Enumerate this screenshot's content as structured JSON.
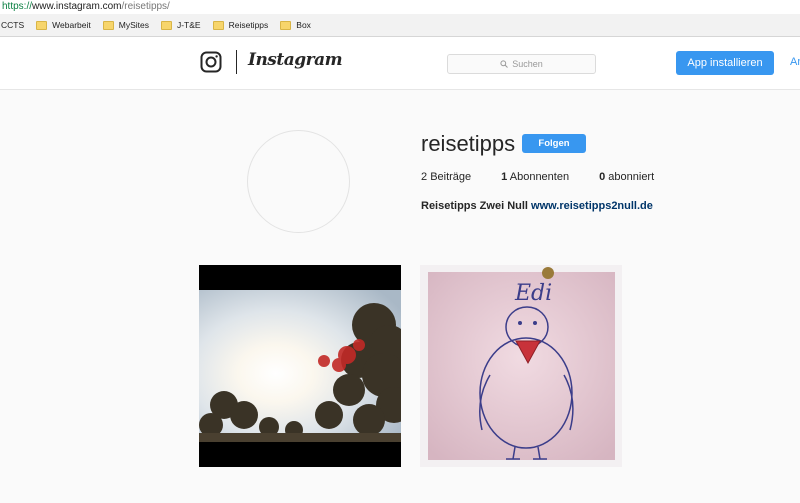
{
  "browser": {
    "url_scheme": "https://",
    "url_host": "www.instagram.com",
    "url_path": "/reisetipps/",
    "bookmarks": [
      "CCTS",
      "Webarbeit",
      "MySites",
      "J-T&E",
      "Reisetipps",
      "Box"
    ]
  },
  "header": {
    "logo_text": "Instagram",
    "search_placeholder": "Suchen",
    "app_button": "App installieren",
    "login_link": "An"
  },
  "profile": {
    "username": "reisetipps",
    "follow_label": "Folgen",
    "posts_count": "2",
    "posts_label": "Beiträge",
    "followers_count": "1",
    "followers_label": "Abonnenten",
    "following_count": "0",
    "following_label": "abonniert",
    "bio_name": "Reisetipps Zwei Null",
    "bio_link": "www.reisetipps2null.de"
  },
  "posts": [
    {
      "subject": "sun-through-trees-photo"
    },
    {
      "subject": "edi-bird-drawing-photo",
      "drawn_text": "Edi"
    }
  ],
  "colors": {
    "accent": "#3897f0",
    "link": "#003569",
    "background": "#fafafa"
  }
}
